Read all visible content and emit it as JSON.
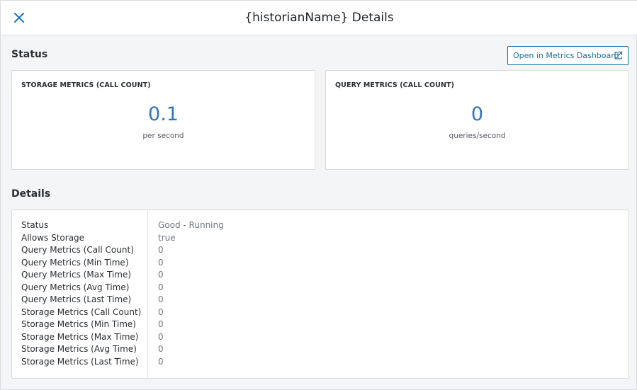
{
  "header": {
    "title": "{historianName} Details",
    "close_icon": "close-icon"
  },
  "status_section": {
    "title": "Status",
    "dashboard_button_label": "Open in Metrics Dashboard",
    "dashboard_button_icon": "external-link-icon",
    "cards": [
      {
        "label": "STORAGE METRICS (CALL COUNT)",
        "value": "0.1",
        "unit": "per second"
      },
      {
        "label": "QUERY METRICS (CALL COUNT)",
        "value": "0",
        "unit": "queries/second"
      }
    ]
  },
  "details_section": {
    "title": "Details",
    "rows": [
      {
        "key": "Status",
        "value": "Good - Running"
      },
      {
        "key": "Allows Storage",
        "value": "true"
      },
      {
        "key": "Query Metrics (Call Count)",
        "value": "0"
      },
      {
        "key": "Query Metrics (Min Time)",
        "value": "0"
      },
      {
        "key": "Query Metrics (Max Time)",
        "value": "0"
      },
      {
        "key": "Query Metrics (Avg Time)",
        "value": "0"
      },
      {
        "key": "Query Metrics (Last Time)",
        "value": "0"
      },
      {
        "key": "Storage Metrics (Call Count)",
        "value": "0"
      },
      {
        "key": "Storage Metrics (Min Time)",
        "value": "0"
      },
      {
        "key": "Storage Metrics (Max Time)",
        "value": "0"
      },
      {
        "key": "Storage Metrics (Avg Time)",
        "value": "0"
      },
      {
        "key": "Storage Metrics (Last Time)",
        "value": "0"
      }
    ]
  },
  "colors": {
    "accent": "#2f74c0",
    "button_border": "#1a6f9e",
    "close_icon": "#1a73b8"
  }
}
